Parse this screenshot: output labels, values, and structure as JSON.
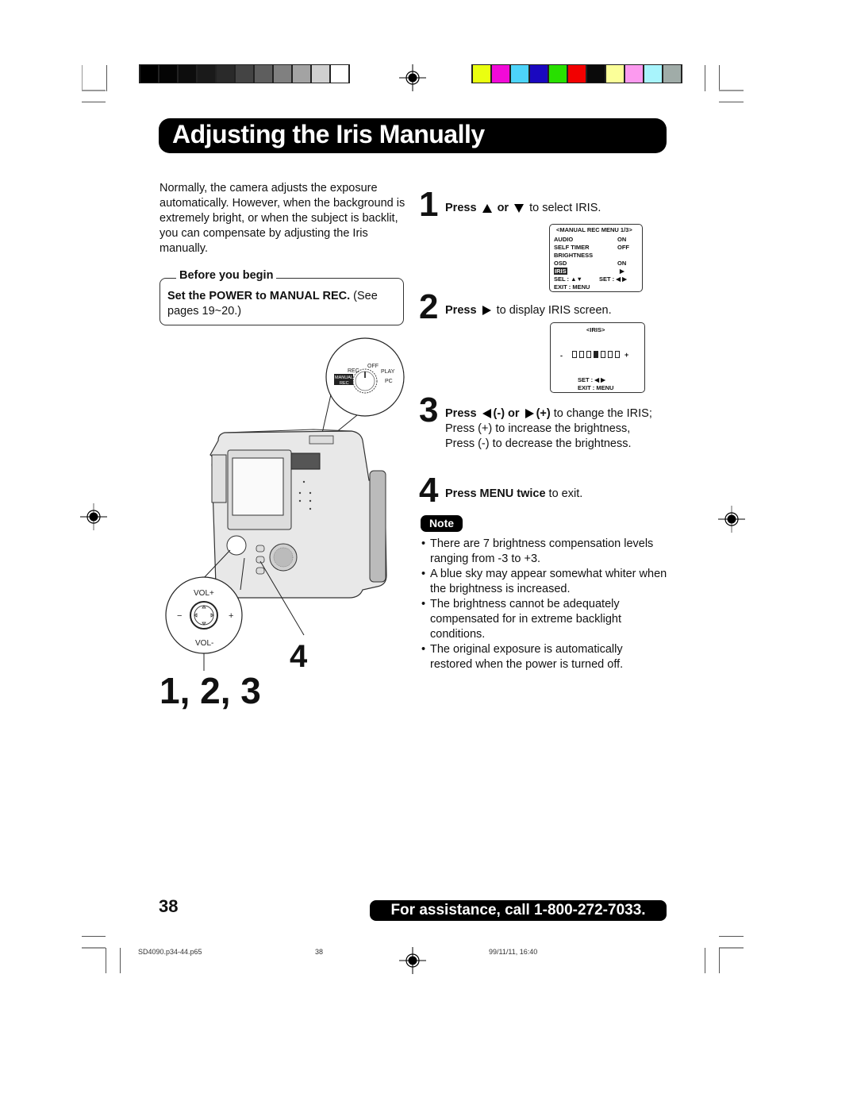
{
  "print_marks": {
    "grayscale_swatches": [
      "#000000",
      "#050505",
      "#0d0d0d",
      "#1a1a1a",
      "#2a2a2a",
      "#444444",
      "#5e5e5e",
      "#808080",
      "#a3a3a3",
      "#d0d0d0",
      "#ffffff"
    ],
    "color_swatches": [
      "#eaff10",
      "#f20ad8",
      "#4dd4fa",
      "#1a08c0",
      "#28e000",
      "#f20000",
      "#0a0a0a",
      "#fbff99",
      "#fc9aef",
      "#a8f4fc",
      "#a0aca8"
    ]
  },
  "title": "Adjusting the Iris Manually",
  "intro": "Normally, the camera adjusts the exposure automatically. However, when the background is extremely bright, or when the subject is backlit, you can compensate by adjusting the Iris manually.",
  "before_you_begin": {
    "heading": "Before you begin",
    "bold": "Set the POWER to MANUAL REC.",
    "rest": " (See pages  19~20.)"
  },
  "illustration": {
    "dial_labels": {
      "off": "OFF",
      "rec": "REC",
      "play": "PLAY",
      "manual_rec": "MANUAL REC",
      "pc": "PC"
    },
    "pad_labels": {
      "vol_plus": "VOL+",
      "vol_minus": "VOL-",
      "minus": "−",
      "plus": "+"
    },
    "callout_123": "1, 2, 3",
    "callout_4": "4"
  },
  "steps": [
    {
      "num": "1",
      "bold": "Press",
      "mid": "or",
      "rest": " to select IRIS."
    },
    {
      "num": "2",
      "bold": "Press",
      "rest": " to display IRIS screen."
    },
    {
      "num": "3",
      "bold_a": "Press",
      "bold_b": "(-) or",
      "bold_c": "(+)",
      "rest": " to change the IRIS;",
      "line2": "Press (+) to increase the brightness,",
      "line3": "Press (-) to decrease the brightness."
    },
    {
      "num": "4",
      "bold": "Press MENU twice",
      "rest": " to exit."
    }
  ],
  "osd_menu": {
    "header": "<MANUAL REC MENU 1/3>",
    "rows": [
      {
        "label": "AUDIO",
        "value": "ON"
      },
      {
        "label": "SELF TIMER",
        "value": "OFF"
      },
      {
        "label": "BRIGHTNESS",
        "value": ""
      },
      {
        "label": "OSD",
        "value": "ON"
      },
      {
        "label": "IRIS",
        "value": "▶",
        "selected": true
      }
    ],
    "sel": "SEL   : ▲▼",
    "set": "SET   : ◀ ▶",
    "exit": "EXIT  : MENU"
  },
  "osd_iris": {
    "header": "<IRIS>",
    "minus": "-",
    "plus": "+",
    "levels": 7,
    "current_level": 4,
    "set": "SET  : ◀ ▶",
    "exit": "EXIT : MENU"
  },
  "note": {
    "label": "Note",
    "items": [
      "There are 7 brightness compensation levels ranging from -3 to +3.",
      "A blue sky may appear somewhat whiter when the brightness is increased.",
      "The brightness cannot be adequately compensated for in extreme backlight conditions.",
      "The original exposure is automatically restored when the power is turned off."
    ]
  },
  "page_number": "38",
  "assistance": "For assistance, call 1-800-272-7033.",
  "footer": {
    "file": "SD4090.p34-44.p65",
    "page": "38",
    "timestamp": "99/11/11, 16:40"
  }
}
